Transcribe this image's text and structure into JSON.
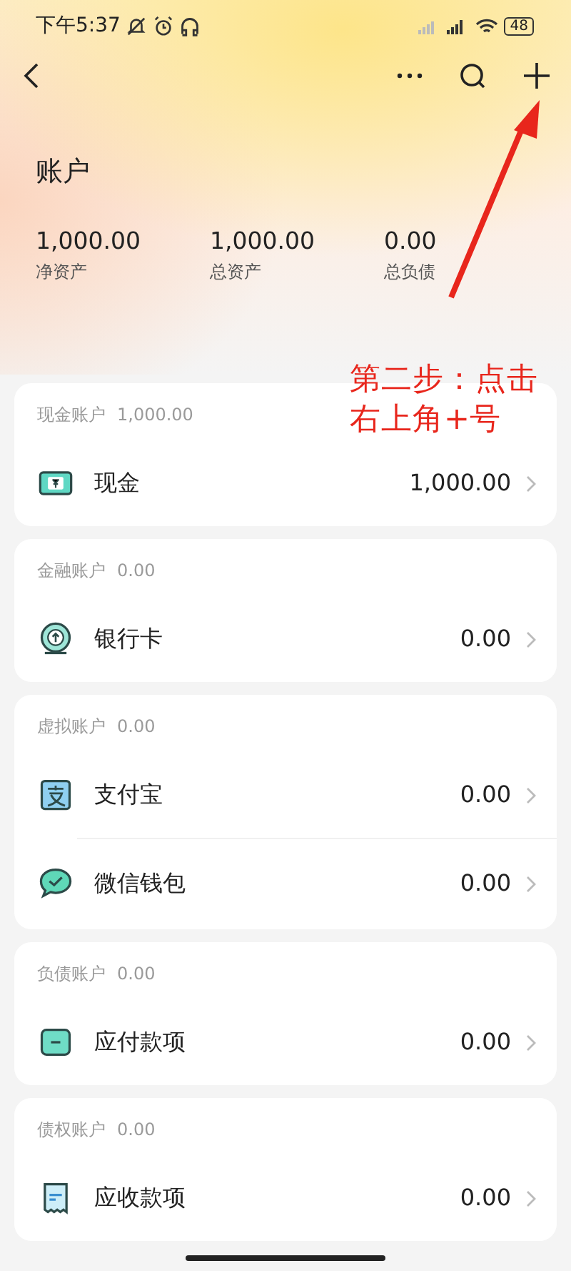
{
  "status_bar": {
    "time": "下午5:37",
    "battery": "48"
  },
  "header": {
    "title": "账户",
    "stats": [
      {
        "value": "1,000.00",
        "label": "净资产"
      },
      {
        "value": "1,000.00",
        "label": "总资产"
      },
      {
        "value": "0.00",
        "label": "总负债"
      }
    ]
  },
  "groups": [
    {
      "title": "现金账户",
      "total": "1,000.00",
      "accounts": [
        {
          "kind": "cash",
          "name": "现金",
          "amount": "1,000.00"
        }
      ]
    },
    {
      "title": "金融账户",
      "total": "0.00",
      "accounts": [
        {
          "kind": "bank",
          "name": "银行卡",
          "amount": "0.00"
        }
      ]
    },
    {
      "title": "虚拟账户",
      "total": "0.00",
      "accounts": [
        {
          "kind": "alipay",
          "name": "支付宝",
          "amount": "0.00"
        },
        {
          "kind": "wechat",
          "name": "微信钱包",
          "amount": "0.00"
        }
      ]
    },
    {
      "title": "负债账户",
      "total": "0.00",
      "accounts": [
        {
          "kind": "payable",
          "name": "应付款项",
          "amount": "0.00"
        }
      ]
    },
    {
      "title": "债权账户",
      "total": "0.00",
      "accounts": [
        {
          "kind": "receivable",
          "name": "应收款项",
          "amount": "0.00"
        }
      ]
    }
  ],
  "annotation": {
    "lines": [
      "第二步：点击",
      "右上角+号"
    ]
  }
}
